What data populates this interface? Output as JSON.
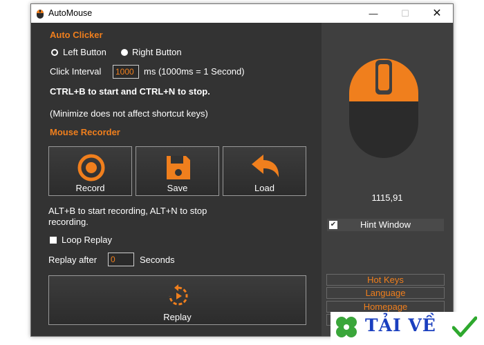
{
  "window": {
    "title": "AutoMouse",
    "min_glyph": "—",
    "max_glyph": "☐",
    "close_glyph": "✕"
  },
  "auto_clicker": {
    "title": "Auto Clicker",
    "left_button": "Left Button",
    "right_button": "Right Button",
    "selected": "Right Button",
    "interval_label": "Click Interval",
    "interval_value": "1000",
    "interval_unit": "ms (1000ms = 1 Second)",
    "shortcut_text": "CTRL+B to start and CTRL+N to stop.",
    "minimize_note": "(Minimize does not affect shortcut keys)"
  },
  "mouse_recorder": {
    "title": "Mouse Recorder",
    "record_label": "Record",
    "save_label": "Save",
    "load_label": "Load",
    "shortcut_line1": "ALT+B to start recording, ALT+N to stop",
    "shortcut_line2": "recording.",
    "loop_replay_label": "Loop Replay",
    "loop_replay_checked": false,
    "replay_after_label": "Replay after",
    "replay_after_value": "0",
    "replay_after_unit": "Seconds",
    "replay_label": "Replay"
  },
  "side_panel": {
    "coordinates": "1115,91",
    "hint_window_label": "Hint Window",
    "hint_window_checked": true,
    "hot_keys": "Hot Keys",
    "language": "Language",
    "homepage": "Homepage"
  },
  "colors": {
    "accent": "#f07f1d",
    "background": "#333333",
    "panel": "#3f3f3f",
    "mouse_body": "#2b2b2b"
  },
  "watermark": {
    "text": "TẢI VỀ"
  }
}
